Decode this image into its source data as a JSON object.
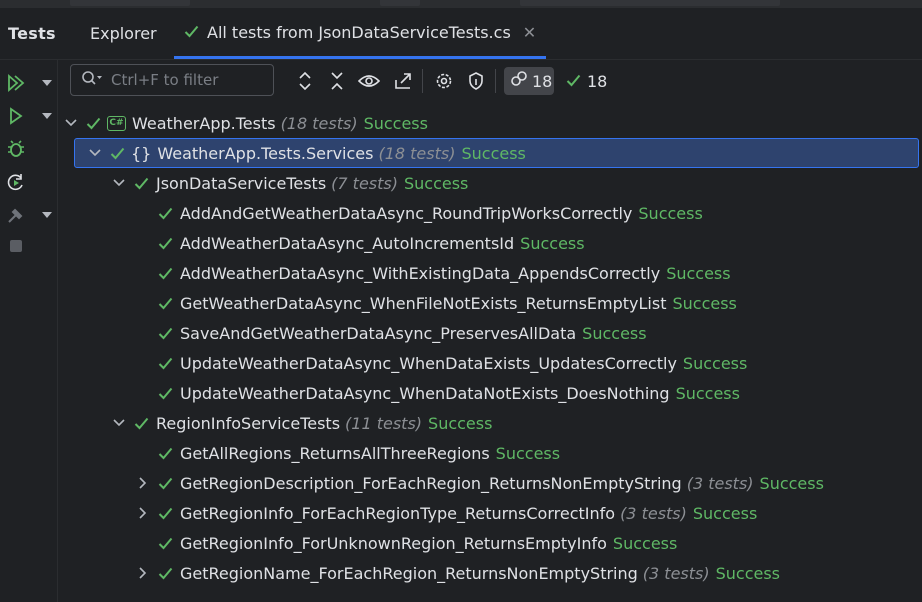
{
  "window": {
    "panel_title": "Tests",
    "tabs": [
      {
        "label": "Explorer",
        "active": false
      },
      {
        "label": "All tests from JsonDataServiceTests.cs",
        "active": true,
        "closable": true
      }
    ]
  },
  "toolbar": {
    "filter_placeholder": "Ctrl+F to filter",
    "total_count": "18",
    "passed_count": "18",
    "icons": [
      "search-icon",
      "expand-all-icon",
      "collapse-all-icon",
      "show-passed-icon",
      "export-icon",
      "settings-icon",
      "pin-icon",
      "tests-count-icon",
      "passed-check-icon"
    ]
  },
  "sidebar": {
    "icons": [
      "run-all-icon",
      "run-icon",
      "debug-icon",
      "rerun-icon",
      "coverage-icon",
      "stop-icon"
    ]
  },
  "colors": {
    "success": "#5fb865",
    "accent": "#3574f0",
    "selection": "#2e436e",
    "background": "#1f2124"
  },
  "tree": [
    {
      "caret": "down",
      "icon": "csharp",
      "name": "WeatherApp.Tests",
      "count": "(18 tests)",
      "status": "Success"
    },
    {
      "caret": "down",
      "icon": "namespace",
      "name": "WeatherApp.Tests.Services",
      "count": "(18 tests)",
      "status": "Success",
      "selected": true
    },
    {
      "caret": "down",
      "name": "JsonDataServiceTests",
      "count": "(7 tests)",
      "status": "Success"
    },
    {
      "name": "AddAndGetWeatherDataAsync_RoundTripWorksCorrectly",
      "status": "Success"
    },
    {
      "name": "AddWeatherDataAsync_AutoIncrementsId",
      "status": "Success"
    },
    {
      "name": "AddWeatherDataAsync_WithExistingData_AppendsCorrectly",
      "status": "Success"
    },
    {
      "name": "GetWeatherDataAsync_WhenFileNotExists_ReturnsEmptyList",
      "status": "Success"
    },
    {
      "name": "SaveAndGetWeatherDataAsync_PreservesAllData",
      "status": "Success"
    },
    {
      "name": "UpdateWeatherDataAsync_WhenDataExists_UpdatesCorrectly",
      "status": "Success"
    },
    {
      "name": "UpdateWeatherDataAsync_WhenDataNotExists_DoesNothing",
      "status": "Success"
    },
    {
      "caret": "down",
      "name": "RegionInfoServiceTests",
      "count": "(11 tests)",
      "status": "Success"
    },
    {
      "name": "GetAllRegions_ReturnsAllThreeRegions",
      "status": "Success"
    },
    {
      "caret": "right",
      "name": "GetRegionDescription_ForEachRegion_ReturnsNonEmptyString",
      "count": "(3 tests)",
      "status": "Success"
    },
    {
      "caret": "right",
      "name": "GetRegionInfo_ForEachRegionType_ReturnsCorrectInfo",
      "count": "(3 tests)",
      "status": "Success"
    },
    {
      "name": "GetRegionInfo_ForUnknownRegion_ReturnsEmptyInfo",
      "status": "Success"
    },
    {
      "caret": "right",
      "name": "GetRegionName_ForEachRegion_ReturnsNonEmptyString",
      "count": "(3 tests)",
      "status": "Success"
    }
  ]
}
